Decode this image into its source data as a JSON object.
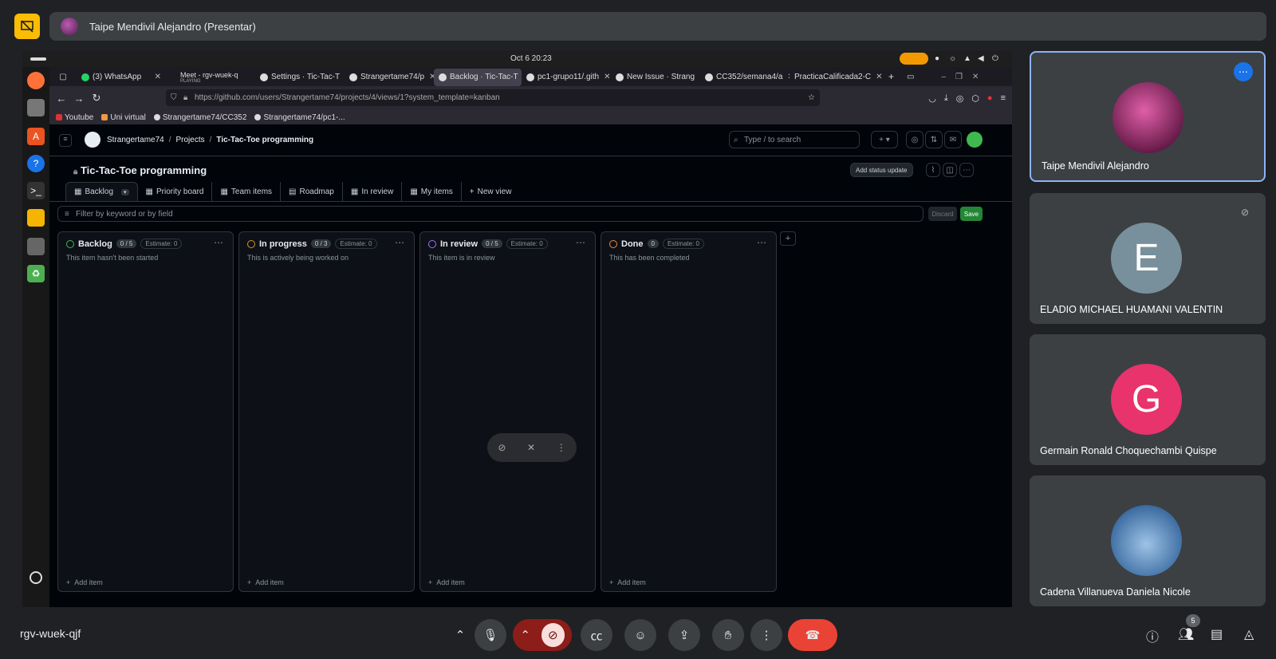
{
  "presenter": {
    "name": "Taipe Mendivil Alejandro (Presentar)"
  },
  "screen": {
    "clock": "Oct 6  20:23",
    "tabs": [
      {
        "label": "(3) WhatsApp"
      },
      {
        "label": "Meet - rgv-wuek-q",
        "sub": "PLAYING"
      },
      {
        "label": "Settings · Tic-Tac-T"
      },
      {
        "label": "Strangertame74/p"
      },
      {
        "label": "Backlog · Tic-Tac-T"
      },
      {
        "label": "pc1-grupo11/.gith"
      },
      {
        "label": "New Issue · Strang"
      },
      {
        "label": "CC352/semana4/a"
      },
      {
        "label": "PracticaCalificada2-C"
      }
    ],
    "url": "https://github.com/users/Strangertame74/projects/4/views/1?system_template=kanban",
    "bookmarks": [
      "Youtube",
      "Uni virtual",
      "Strangertame74/CC352",
      "Strangertame74/pc1-..."
    ],
    "github": {
      "breadcrumb": {
        "owner": "Strangertame74",
        "section": "Projects",
        "project": "Tic-Tac-Toe programming"
      },
      "search_placeholder": "Type / to search",
      "project_title": "Tic-Tac-Toe programming",
      "status_update": "Add status update",
      "views": [
        "Backlog",
        "Priority board",
        "Team items",
        "Roadmap",
        "In review",
        "My items",
        "New view"
      ],
      "filter_placeholder": "Filter by keyword or by field",
      "discard": "Discard",
      "save": "Save",
      "columns": [
        {
          "title": "Backlog",
          "count": "0 / 5",
          "estimate": "Estimate: 0",
          "desc": "This item hasn't been started",
          "color": "#3fb950",
          "add": "Add item"
        },
        {
          "title": "In progress",
          "count": "0 / 3",
          "estimate": "Estimate: 0",
          "desc": "This is actively being worked on",
          "color": "#d29922",
          "add": "Add item"
        },
        {
          "title": "In review",
          "count": "0 / 5",
          "estimate": "Estimate: 0",
          "desc": "This item is in review",
          "color": "#a371f7",
          "add": "Add item"
        },
        {
          "title": "Done",
          "count": "0",
          "estimate": "Estimate: 0",
          "desc": "This has been completed",
          "color": "#f0883e",
          "add": "Add item"
        }
      ]
    }
  },
  "participants": [
    {
      "name": "Taipe Mendivil Alejandro",
      "initial": "",
      "color": "#8e2d6e"
    },
    {
      "name": "ELADIO MICHAEL HUAMANI VALENTIN",
      "initial": "E",
      "color": "#78909c"
    },
    {
      "name": "Germain Ronald Choquechambi Quispe",
      "initial": "G",
      "color": "#e8336d"
    },
    {
      "name": "Cadena Villanueva Daniela Nicole",
      "initial": "",
      "color": "#5b7fae"
    }
  ],
  "meeting": {
    "code": "rgv-wuek-qjf",
    "people_count": "5"
  }
}
